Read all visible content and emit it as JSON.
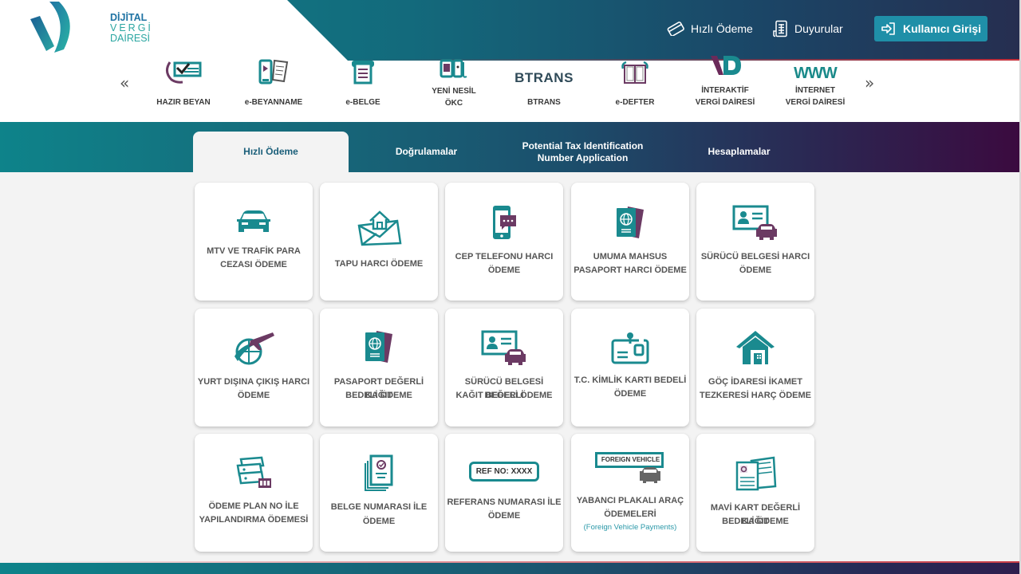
{
  "logo": {
    "line1": "DİJİTAL",
    "line2": "VERGİ",
    "line3": "DAİRESİ"
  },
  "header": {
    "quick_payment": "Hızlı Ödeme",
    "announcements": "Duyurular",
    "login": "Kullanıcı Girişi"
  },
  "carousel": {
    "prev": "«",
    "next": "»",
    "items": [
      {
        "label": "HAZIR BEYAN",
        "icon": "checklist-icon"
      },
      {
        "label": "e-BEYANNAME",
        "icon": "phone-document-icon"
      },
      {
        "label": "e-BELGE",
        "icon": "printer-document-icon"
      },
      {
        "label": "YENİ NESİL\nÖKC",
        "line1": "YENİ NESİL",
        "line2": "ÖKC",
        "icon": "pos-device-icon"
      },
      {
        "label": "BTRANS",
        "logo_text": "BTRANS",
        "icon": "btrans-logo"
      },
      {
        "label": "e-DEFTER",
        "icon": "book-icon"
      },
      {
        "label": "İNTERAKTİF VERGİ DAİRESİ",
        "line1": "İNTERAKTİF",
        "line2": "VERGİ DAİRESİ",
        "logo_text": "VD",
        "icon": "vd-logo"
      },
      {
        "label": "İNTERNET VERGİ DAİRESİ",
        "line1": "İNTERNET",
        "line2": "VERGİ DAİRESİ",
        "logo_text": "WWW",
        "icon": "www-logo"
      }
    ]
  },
  "tabs": [
    {
      "label": "Hızlı Ödeme",
      "active": true
    },
    {
      "label": "Doğrulamalar",
      "active": false
    },
    {
      "line1": "Potential Tax Identification",
      "line2": "Number Application",
      "active": false
    },
    {
      "label": "Hesaplamalar",
      "active": false
    }
  ],
  "cards": [
    {
      "line1": "MTV VE TRAFİK PARA",
      "line2": "CEZASI ÖDEME",
      "icon": "car-icon"
    },
    {
      "line1": "TAPU HARCI ÖDEME",
      "line2": "",
      "icon": "land-deed-house-icon"
    },
    {
      "line1": "CEP TELEFONU HARCI",
      "line2": "ÖDEME",
      "icon": "mobile-phone-chat-icon"
    },
    {
      "line1": "UMUMA MAHSUS",
      "line2": "PASAPORT HARCI ÖDEME",
      "icon": "passport-icon"
    },
    {
      "line1": "SÜRÜCÜ BELGESİ HARCI",
      "line2": "ÖDEME",
      "icon": "driver-license-car-icon"
    },
    {
      "line1": "YURT DIŞINA ÇIKIŞ HARCI",
      "line2": "ÖDEME",
      "icon": "globe-airplane-icon"
    },
    {
      "line1": "PASAPORT DEĞERLİ KAĞIT",
      "line2": "BEDELİ ÖDEME",
      "icon": "passport-icon"
    },
    {
      "line1": "SÜRÜCÜ BELGESİ DEĞERLİ",
      "line2": "KAĞIT BEDELİ ÖDEME",
      "icon": "driver-license-car-icon"
    },
    {
      "line1": "T.C. KİMLİK KARTI BEDELİ",
      "line2": "ÖDEME",
      "icon": "id-card-icon"
    },
    {
      "line1": "GÖÇ İDARESİ İKAMET",
      "line2": "TEZKERESİ HARÇ ÖDEME",
      "icon": "house-icon"
    },
    {
      "line1": "ÖDEME PLAN NO İLE",
      "line2": "YAPILANDIRMA ÖDEMESİ",
      "icon": "banknotes-calendar-icon"
    },
    {
      "line1": "BELGE NUMARASI İLE",
      "line2": "ÖDEME",
      "icon": "document-stack-check-icon"
    },
    {
      "line1": "REFERANS NUMARASI İLE",
      "line2": "ÖDEME",
      "icon": "ref-no-badge-icon",
      "badge_text": "REF NO: XXXX"
    },
    {
      "line1": "YABANCI PLAKALI ARAÇ",
      "line2": "ÖDEMELERİ",
      "sub": "(Foreign Vehicle Payments)",
      "icon": "foreign-vehicle-icon",
      "badge_text": "FOREIGN VEHICLE"
    },
    {
      "line1": "MAVİ KART DEĞERLİ KAĞIT",
      "line2": "BEDELİ ÖDEME",
      "icon": "blue-card-documents-icon"
    }
  ],
  "colors": {
    "teal": "#1a8a8f",
    "purple": "#6b3a63",
    "header_dark": "#262e50",
    "login_button": "#1f8fa8",
    "tab_active_text": "#1b5f7a",
    "card_text": "#555555"
  }
}
